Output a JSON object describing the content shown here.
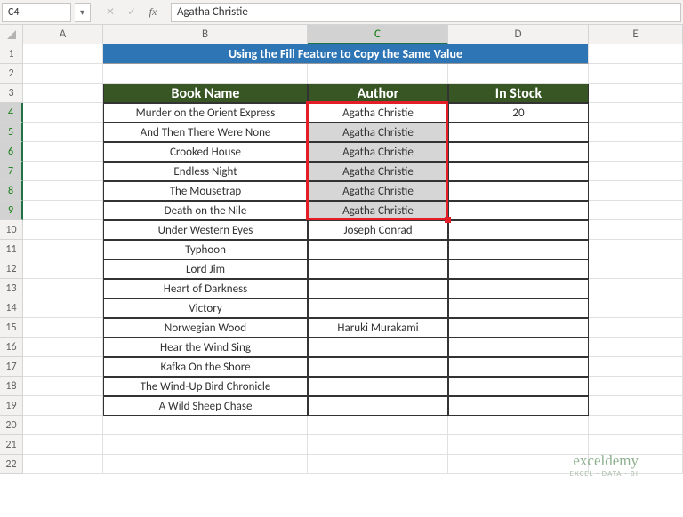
{
  "nameBox": "C4",
  "formulaBar": "Agatha Christie",
  "columns": [
    {
      "label": "A",
      "width": "colA",
      "selected": false
    },
    {
      "label": "B",
      "width": "colB",
      "selected": false
    },
    {
      "label": "C",
      "width": "colC",
      "selected": true
    },
    {
      "label": "D",
      "width": "colD",
      "selected": false
    },
    {
      "label": "E",
      "width": "colE",
      "selected": false
    }
  ],
  "rowNumbers": [
    1,
    2,
    3,
    4,
    5,
    6,
    7,
    8,
    9,
    10,
    11,
    12,
    13,
    14,
    15,
    16,
    17,
    18,
    19,
    20,
    21,
    22
  ],
  "selectedRows": [
    4,
    5,
    6,
    7,
    8,
    9
  ],
  "title": "Using the Fill Feature to Copy the Same Value",
  "headers": {
    "b": "Book Name",
    "c": "Author",
    "d": "In Stock"
  },
  "data": [
    {
      "b": "Murder on the Orient Express",
      "c": "Agatha Christie",
      "d": "20",
      "selC": true,
      "active": true
    },
    {
      "b": "And Then There Were None",
      "c": "Agatha Christie",
      "d": "",
      "selC": true
    },
    {
      "b": "Crooked House",
      "c": "Agatha Christie",
      "d": "",
      "selC": true
    },
    {
      "b": "Endless Night",
      "c": "Agatha Christie",
      "d": "",
      "selC": true
    },
    {
      "b": "The Mousetrap",
      "c": "Agatha Christie",
      "d": "",
      "selC": true
    },
    {
      "b": "Death on the Nile",
      "c": "Agatha Christie",
      "d": "",
      "selC": true
    },
    {
      "b": "Under Western Eyes",
      "c": "Joseph Conrad",
      "d": ""
    },
    {
      "b": "Typhoon",
      "c": "",
      "d": ""
    },
    {
      "b": "Lord Jim",
      "c": "",
      "d": ""
    },
    {
      "b": "Heart of Darkness",
      "c": "",
      "d": ""
    },
    {
      "b": "Victory",
      "c": "",
      "d": ""
    },
    {
      "b": "Norwegian Wood",
      "c": "Haruki Murakami",
      "d": ""
    },
    {
      "b": "Hear the Wind Sing",
      "c": "",
      "d": ""
    },
    {
      "b": "Kafka On the Shore",
      "c": "",
      "d": ""
    },
    {
      "b": "The Wind-Up Bird Chronicle",
      "c": "",
      "d": ""
    },
    {
      "b": "A Wild Sheep Chase",
      "c": "",
      "d": ""
    }
  ],
  "watermark": {
    "line1": "exceldemy",
    "line2": "EXCEL · DATA · BI"
  }
}
